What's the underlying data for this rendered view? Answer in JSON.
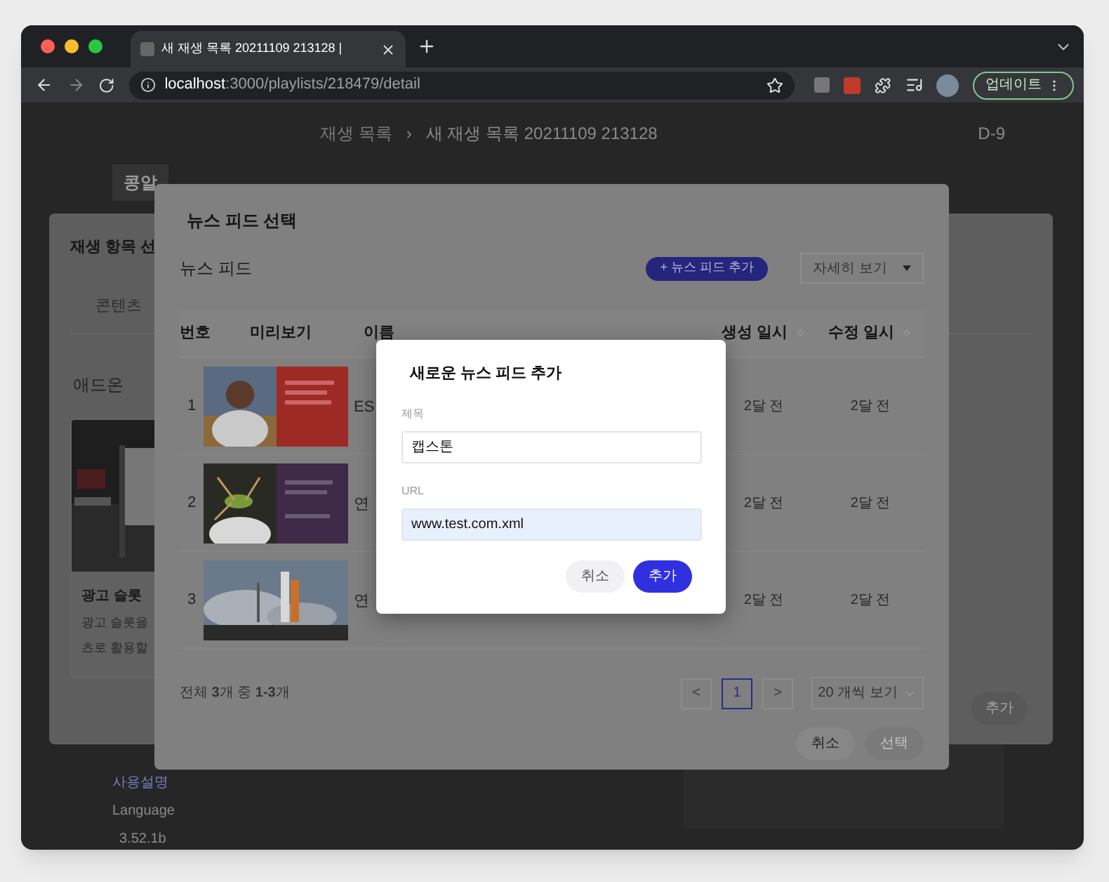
{
  "browser": {
    "tab_title": "새 재생 목록 20211109 213128 |",
    "url_host": "localhost",
    "url_path": ":3000/playlists/218479/detail",
    "update_button": "업데이트"
  },
  "page": {
    "breadcrumb": [
      "재생 목록",
      "새 재생 목록 20211109 213128"
    ],
    "breadcrumb_separator": "›",
    "badge": "D-9",
    "tag": "콩알",
    "footer": [
      "사용설명",
      "Language",
      "3.52.1b"
    ]
  },
  "playlist_panel": {
    "title": "재생 항목 선",
    "tab": "콘텐츠",
    "section": "애드온",
    "card": {
      "title": "광고 슬롯",
      "description": [
        "광고 슬롯을",
        "츠로 활용할"
      ]
    },
    "add_button": "추가"
  },
  "feed_dialog": {
    "title": "뉴스 피드 선택",
    "section": "뉴스 피드",
    "add_button": "+ 뉴스 피드 추가",
    "view_select": "자세히 보기",
    "columns": [
      {
        "label": "번호",
        "sortable": false
      },
      {
        "label": "미리보기",
        "sortable": false
      },
      {
        "label": "이름",
        "sortable": false
      },
      {
        "label": "생성 일시",
        "sortable": true
      },
      {
        "label": "수정 일시",
        "sortable": true
      }
    ],
    "rows": [
      {
        "number": "1",
        "kind": "sports",
        "name": "ES",
        "created": "2달 전",
        "modified": "2달 전"
      },
      {
        "number": "2",
        "kind": "insect",
        "name": "연",
        "created": "2달 전",
        "modified": "2달 전"
      },
      {
        "number": "3",
        "kind": "rocket",
        "name": "연",
        "created": "2달 전",
        "modified": "2달 전"
      }
    ],
    "summary": "전체 **3**개 중 **1-3**개",
    "prev": "<",
    "pages": [
      {
        "label": "1",
        "selected": true
      }
    ],
    "next": ">",
    "page_size": "20 개씩 보기",
    "cancel_button": "취소",
    "select_button": {
      "label": "선택",
      "disabled": true
    }
  },
  "add_feed_dialog": {
    "title": "새로운 뉴스 피드 추가",
    "fields": [
      {
        "label": "제목",
        "value": "캡스톤",
        "autofilled": false
      },
      {
        "label": "URL",
        "value": "www.test.com.xml",
        "autofilled": true
      }
    ],
    "cancel_button": "취소",
    "add_button": "추가"
  }
}
